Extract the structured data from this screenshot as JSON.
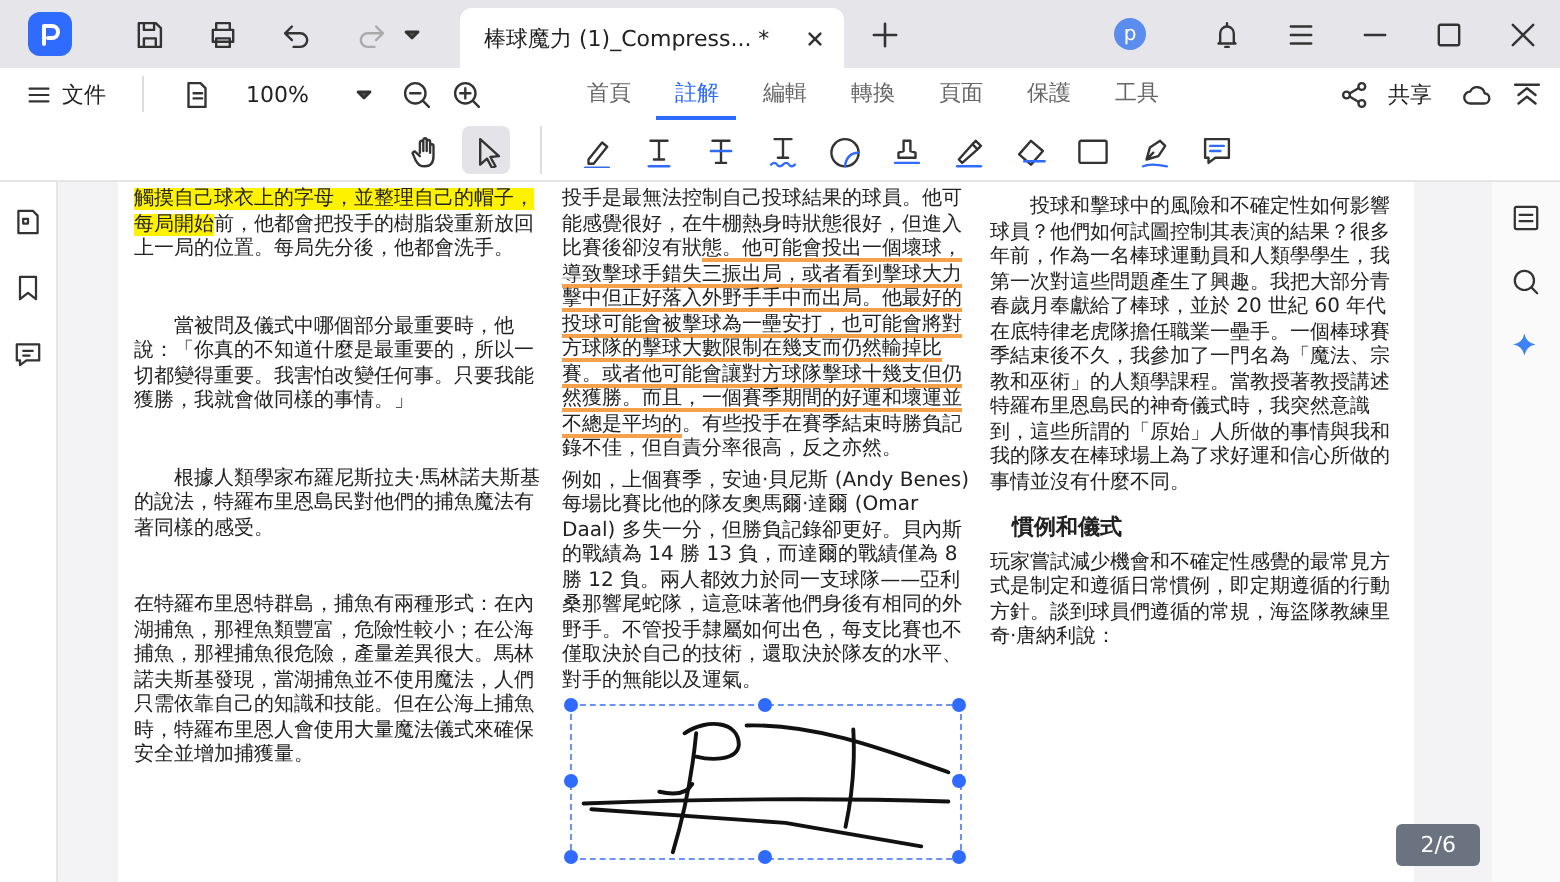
{
  "window": {
    "tab_title": "棒球魔力 (1)_Compress... *",
    "avatar": "p"
  },
  "menu": {
    "file": "文件",
    "zoom": "100%",
    "share": "共享"
  },
  "ribbon_tabs": [
    {
      "label": "首頁",
      "selected": false
    },
    {
      "label": "註解",
      "selected": true
    },
    {
      "label": "編輯",
      "selected": false
    },
    {
      "label": "轉換",
      "selected": false
    },
    {
      "label": "頁面",
      "selected": false
    },
    {
      "label": "保護",
      "selected": false
    },
    {
      "label": "工具",
      "selected": false
    }
  ],
  "nav_tools": [
    {
      "kind": "hand",
      "selected": false
    },
    {
      "kind": "select",
      "selected": true
    }
  ],
  "markup_tools": [
    {
      "kind": "highlight"
    },
    {
      "kind": "underline"
    },
    {
      "kind": "strikeout"
    },
    {
      "kind": "squiggly"
    },
    {
      "kind": "shape"
    },
    {
      "kind": "stamp"
    },
    {
      "kind": "signature"
    },
    {
      "kind": "eraser"
    },
    {
      "kind": "rectangle"
    },
    {
      "kind": "pen"
    },
    {
      "kind": "comment"
    }
  ],
  "document": {
    "columns": [
      {
        "paragraphs": [
          {
            "kind": "body",
            "segments": [
              {
                "text": "觸摸自己球衣上的字母，並整理自己的帽子，每局開始",
                "kind": "highlighted"
              },
              {
                "text": "前，他都會把投手的樹脂袋重新放回上一局的位置。每局先分後，他都會洗手。",
                "kind": "plain"
              }
            ]
          },
          {
            "kind": "indent",
            "segments": [
              {
                "text": "當被問及儀式中哪個部分最重要時，他說：「你真的不知道什麼是最重要的，所以一切都變得重要。我害怕改變任何事。只要我能獲勝，我就會做同樣的事情。」",
                "kind": "plain"
              }
            ]
          },
          {
            "kind": "indent",
            "segments": [
              {
                "text": "根據人類學家布羅尼斯拉夫·馬林諾夫斯基的說法，特羅布里恩島民對他們的捕魚魔法有著同樣的感受。",
                "kind": "plain"
              }
            ]
          },
          {
            "kind": "body",
            "segments": [
              {
                "text": "在特羅布里恩特群島，捕魚有兩種形式：在內湖捕魚，那裡魚類豐富，危險性較小；在公海捕魚，那裡捕魚很危險，產量差異很大。馬林諾夫斯基發現，當湖捕魚並不使用魔法，人們只需依靠自己的知識和技能。但在公海上捕魚時，特羅布里恩人會使用大量魔法儀式來確保安全並增加捕獲量。",
                "kind": "plain"
              }
            ]
          }
        ]
      },
      {
        "paragraphs": [
          {
            "kind": "body",
            "segments": [
              {
                "text": "投手是最無法控制自己投球結果的球員。他可能感覺很好，在牛棚熱身時狀態很好，但進入比賽後卻沒有狀",
                "kind": "plain"
              },
              {
                "text": "態。他可能會投出一個壞球，導致擊球手錯失三振出局，或者看到擊球大力擊中但正好落入外野手手中而出局。他最好的投球可能會被擊球為一壘安打，也可能會將對方球隊的擊球大數限制在幾支而仍然輸掉比賽。或者他可能會讓對方球隊擊球十幾支但仍然獲勝。而且，一個賽季期間的好運和壞運並不總是平均的",
                "kind": "underlined"
              },
              {
                "text": "。有些投手在賽季結束時勝負記錄不佳，但自責分率很高，反之亦然。",
                "kind": "plain"
              }
            ]
          },
          {
            "kind": "body",
            "segments": [
              {
                "text": "例如，上個賽季，安迪·貝尼斯 (Andy Benes) 每場比賽比他的隊友奧馬爾·達爾 (Omar Daal) 多失一分，但勝負記錄卻更好。貝內斯的戰績為 14 勝 13 負，而達爾的戰績僅為 8 勝 12 負。兩人都效力於同一支球隊——亞利桑那響尾蛇隊，這意味著他們身後有相同的外野手。不管投手隸屬如何出色，每支比賽也不僅取決於自己的技術，還取決於隊友的水平、對手的無能以及運氣。",
                "kind": "plain"
              }
            ]
          }
        ]
      },
      {
        "paragraphs": [
          {
            "kind": "indent",
            "segments": [
              {
                "text": "投球和擊球中的風險和不確定性如何影響球員？他們如何試圖控制其表演的結果？很多年前，作為一名棒球運動員和人類學學生，我第一次對這些問題產生了興趣。我把大部分青春歲月奉獻給了棒球，並於 20 世紀 60 年代在底特律老虎隊擔任職業一壘手。一個棒球賽季結束後不久，我參加了一門名為「魔法、宗教和巫術」的人類學課程。當教授著教授講述特羅布里恩島民的神奇儀式時，我突然意識到，這些所謂的「原始」人所做的事情與我和我的隊友在棒球場上為了求好運和信心所做的事情並沒有什麼不同。",
                "kind": "plain"
              }
            ]
          },
          {
            "kind": "heading",
            "segments": [
              {
                "text": "慣例和儀式",
                "kind": "plain"
              }
            ]
          },
          {
            "kind": "body",
            "segments": [
              {
                "text": "玩家嘗試減少機會和不確定性感覺的最常見方式是制定和遵循日常慣例，即定期遵循的行動方針。談到球員們遵循的常規，海盜隊教練里奇·唐納利說：",
                "kind": "plain"
              }
            ]
          }
        ]
      }
    ]
  },
  "page_indicator": "2/6"
}
